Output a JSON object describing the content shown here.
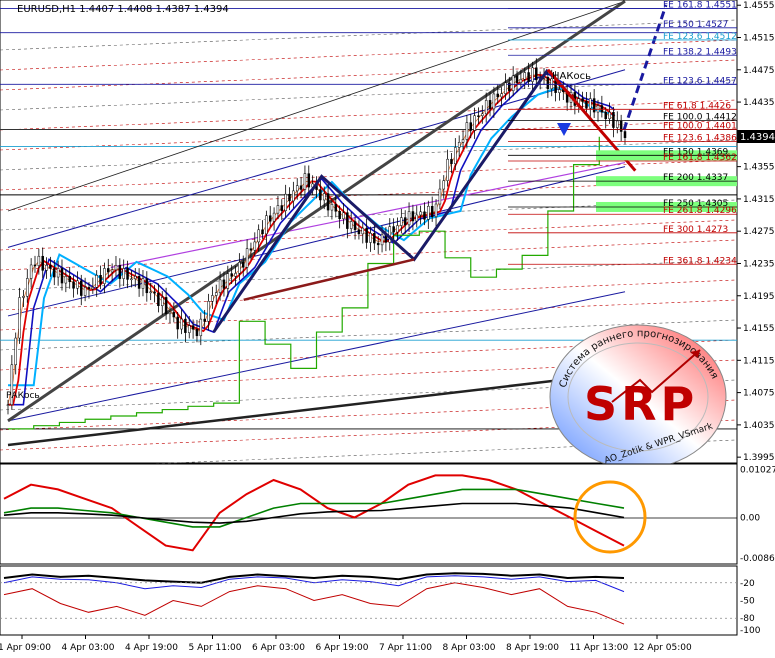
{
  "chart_data": [
    {
      "type": "line",
      "title": "EURUSD,H1 1.4407 1.4408 1.4387 1.4394",
      "symbol": "EURUSD,H1",
      "ohlc": {
        "open": 1.4407,
        "high": 1.4408,
        "low": 1.4387,
        "close": 1.4394
      },
      "current_price_label": "1.4394",
      "ylim": [
        1.3989,
        1.4559
      ],
      "y_ticks": [
        1.3995,
        1.4035,
        1.4075,
        1.4115,
        1.4155,
        1.4195,
        1.4235,
        1.4275,
        1.4315,
        1.4355,
        1.4395,
        1.4435,
        1.4475,
        1.4515,
        1.4555
      ],
      "y_tick_labels": [
        "1.3995",
        "1.4035",
        "1.4075",
        "1.4115",
        "1.4155",
        "1.4195",
        "1.4235",
        "1.4275",
        "1.4315",
        "1.4355",
        "1.4395",
        "1.4435",
        "1.4475",
        "1.4515",
        "1.4555"
      ],
      "x_tick_labels": [
        "1 Apr 09:00",
        "4 Apr 03:00",
        "4 Apr 19:00",
        "5 Apr 11:00",
        "6 Apr 03:00",
        "6 Apr 19:00",
        "7 Apr 11:00",
        "8 Apr 03:00",
        "8 Apr 19:00",
        "11 Apr 13:00",
        "12 Apr 05:00"
      ],
      "x_range_bars": [
        0,
        240
      ],
      "x_tick_bars": [
        0,
        24,
        48,
        72,
        96,
        120,
        144,
        168,
        192,
        216,
        240
      ],
      "close_series": [
        {
          "x": 0,
          "y": 1.406
        },
        {
          "x": 4,
          "y": 1.418
        },
        {
          "x": 10,
          "y": 1.424
        },
        {
          "x": 20,
          "y": 1.422
        },
        {
          "x": 30,
          "y": 1.42
        },
        {
          "x": 40,
          "y": 1.423
        },
        {
          "x": 52,
          "y": 1.421
        },
        {
          "x": 60,
          "y": 1.4185
        },
        {
          "x": 66,
          "y": 1.416
        },
        {
          "x": 74,
          "y": 1.415
        },
        {
          "x": 80,
          "y": 1.42
        },
        {
          "x": 90,
          "y": 1.423
        },
        {
          "x": 100,
          "y": 1.4285
        },
        {
          "x": 110,
          "y": 1.432
        },
        {
          "x": 116,
          "y": 1.434
        },
        {
          "x": 124,
          "y": 1.431
        },
        {
          "x": 134,
          "y": 1.428
        },
        {
          "x": 144,
          "y": 1.426
        },
        {
          "x": 154,
          "y": 1.429
        },
        {
          "x": 166,
          "y": 1.43
        },
        {
          "x": 170,
          "y": 1.435
        },
        {
          "x": 178,
          "y": 1.44
        },
        {
          "x": 186,
          "y": 1.443
        },
        {
          "x": 196,
          "y": 1.446
        },
        {
          "x": 204,
          "y": 1.447
        },
        {
          "x": 212,
          "y": 1.4455
        },
        {
          "x": 218,
          "y": 1.444
        },
        {
          "x": 228,
          "y": 1.443
        },
        {
          "x": 236,
          "y": 1.441
        },
        {
          "x": 240,
          "y": 1.4394
        }
      ],
      "fibonacci_levels": [
        {
          "label": "FE 161.8",
          "value": "1.4551",
          "color": "#1a1aa0"
        },
        {
          "label": "FE 150",
          "value": "1.4527",
          "color": "#1a1aa0"
        },
        {
          "label": "FE 123.6",
          "value": "1.4512",
          "color": "#1a9fd0"
        },
        {
          "label": "FE 138.2",
          "value": "1.4493",
          "color": "#1a1aa0"
        },
        {
          "label": "FE 123.6",
          "value": "1.4457",
          "color": "#1a1aa0"
        },
        {
          "label": "FE 61.8",
          "value": "1.4426",
          "color": "#c00000"
        },
        {
          "label": "FE 100.0",
          "value": "1.4412",
          "color": "#000000"
        },
        {
          "label": "FE 100.0",
          "value": "1.4401",
          "color": "#c00000"
        },
        {
          "label": "FE 123.6",
          "value": "1.4386",
          "color": "#c00000"
        },
        {
          "label": "FE 150",
          "value": "1.4369",
          "color": "#000000"
        },
        {
          "label": "FE 161.8",
          "value": "1.4362",
          "color": "#c00000"
        },
        {
          "label": "FE 200",
          "value": "1.4337",
          "color": "#000000"
        },
        {
          "label": "FE 250",
          "value": "1.4305",
          "color": "#000000"
        },
        {
          "label": "FE 261.8",
          "value": "1.4296",
          "color": "#c00000"
        },
        {
          "label": "FE 300",
          "value": "1.4273",
          "color": "#c00000"
        },
        {
          "label": "FE 361.8",
          "value": "1.4234",
          "color": "#c00000"
        }
      ],
      "chart_annotations": [
        "НАКось",
        "РАКось"
      ],
      "zigzag_pivots": [
        {
          "x": 80,
          "y": 1.415
        },
        {
          "x": 122,
          "y": 1.4343
        },
        {
          "x": 158,
          "y": 1.424
        },
        {
          "x": 210,
          "y": 1.4475
        },
        {
          "x": 244,
          "y": 1.435
        }
      ],
      "grid": false
    },
    {
      "type": "line",
      "title": "",
      "ylim": [
        -0.0095,
        0.011
      ],
      "y_tick_labels": [
        "0.01027",
        "0.00",
        "-0.0086"
      ],
      "series": [
        {
          "color": "#e00000",
          "values": [
            0.004,
            0.007,
            0.006,
            0.004,
            0.002,
            -0.002,
            -0.006,
            -0.007,
            0.001,
            0.005,
            0.008,
            0.006,
            0.002,
            0.0,
            0.003,
            0.007,
            0.009,
            0.009,
            0.008,
            0.006,
            0.003,
            0.0,
            -0.003,
            -0.006
          ]
        },
        {
          "color": "#008000",
          "values": [
            0.001,
            0.002,
            0.002,
            0.0015,
            0.001,
            0.0,
            -0.001,
            -0.002,
            -0.002,
            0.0,
            0.002,
            0.003,
            0.003,
            0.003,
            0.003,
            0.004,
            0.005,
            0.006,
            0.006,
            0.006,
            0.005,
            0.004,
            0.003,
            0.002
          ]
        },
        {
          "color": "#000000",
          "values": [
            0.0005,
            0.001,
            0.001,
            0.0008,
            0.0005,
            0.0,
            -0.0005,
            -0.001,
            -0.0012,
            -0.0008,
            0.0,
            0.0008,
            0.0012,
            0.0014,
            0.0015,
            0.002,
            0.0025,
            0.003,
            0.003,
            0.003,
            0.0025,
            0.002,
            0.001,
            0.0
          ]
        }
      ]
    },
    {
      "type": "line",
      "title": "",
      "ylim": [
        -105,
        5
      ],
      "y_tick_labels": [
        "-20",
        "-50",
        "-80",
        "-100"
      ],
      "series": [
        {
          "color": "#000000",
          "values": [
            -12,
            -6,
            -10,
            -8,
            -12,
            -16,
            -18,
            -20,
            -10,
            -6,
            -9,
            -12,
            -8,
            -10,
            -14,
            -6,
            -4,
            -5,
            -8,
            -6,
            -12,
            -10,
            -12
          ]
        },
        {
          "color": "#1a1ae0",
          "values": [
            -20,
            -10,
            -14,
            -15,
            -20,
            -30,
            -25,
            -28,
            -14,
            -10,
            -12,
            -20,
            -15,
            -18,
            -25,
            -10,
            -8,
            -10,
            -14,
            -10,
            -18,
            -16,
            -35
          ]
        },
        {
          "color": "#c00000",
          "values": [
            -40,
            -30,
            -55,
            -70,
            -60,
            -75,
            -50,
            -60,
            -35,
            -25,
            -30,
            -50,
            -40,
            -55,
            -60,
            -30,
            -20,
            -28,
            -40,
            -30,
            -60,
            -70,
            -90
          ]
        }
      ]
    }
  ],
  "logo": {
    "text": "SRP",
    "ring_text_top": "Система раннего прогнозирования",
    "bottom_text": "AO_Zotik & WPR_VSmark",
    "colors": {
      "gradient_start": "#6fa0ff",
      "gradient_end": "#ff6060",
      "text": "#c00000"
    }
  },
  "colors": {
    "price_axis_box": "#000000",
    "ma_fast": "#00b0ff",
    "ma_slow": "#1010c0",
    "ma_red": "#e00000",
    "kijun": "#22aa00",
    "fib_highlight": "#7dff7d",
    "zigzag": "#1a1a66",
    "highlight_circle": "#ff9900"
  }
}
